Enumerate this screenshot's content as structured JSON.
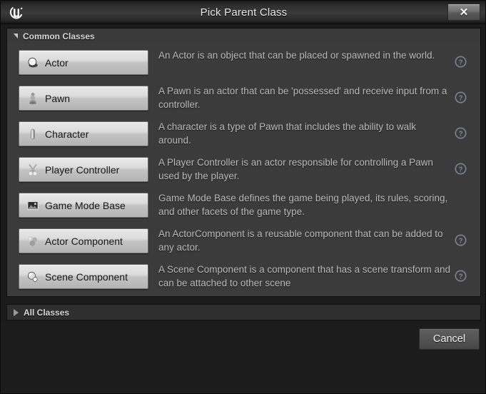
{
  "window": {
    "title": "Pick Parent Class",
    "logo_icon": "unreal-engine-logo",
    "close_icon": "close-icon",
    "close_glyph": "✕"
  },
  "common_section": {
    "label": "Common Classes",
    "expanded": true,
    "expander_icon": "chevron-down-icon",
    "items": [
      {
        "label": "Actor",
        "icon": "actor-sphere-icon",
        "description": "An Actor is an object that can be placed or spawned in the world.",
        "has_help": true,
        "help_icon": "help-circle-icon"
      },
      {
        "label": "Pawn",
        "icon": "pawn-icon",
        "description": "A Pawn is an actor that can be 'possessed' and receive input from a controller.",
        "has_help": true,
        "help_icon": "help-circle-icon"
      },
      {
        "label": "Character",
        "icon": "character-capsule-icon",
        "description": "A character is a type of Pawn that includes the ability to walk around.",
        "has_help": true,
        "help_icon": "help-circle-icon"
      },
      {
        "label": "Player Controller",
        "icon": "player-controller-icon",
        "description": "A Player Controller is an actor responsible for controlling a Pawn used by the player.",
        "has_help": true,
        "help_icon": "help-circle-icon"
      },
      {
        "label": "Game Mode Base",
        "icon": "game-mode-base-icon",
        "description": "Game Mode Base defines the game being played, its rules, scoring, and other facets of the game type.",
        "has_help": false,
        "help_icon": "help-circle-icon"
      },
      {
        "label": "Actor Component",
        "icon": "actor-component-icon",
        "description": "An ActorComponent is a reusable component that can be added to any actor.",
        "has_help": true,
        "help_icon": "help-circle-icon"
      },
      {
        "label": "Scene Component",
        "icon": "scene-component-icon",
        "description": "A Scene Component is a component that has a scene transform and can be attached to other scene",
        "has_help": true,
        "help_icon": "help-circle-icon"
      }
    ]
  },
  "all_section": {
    "label": "All Classes",
    "expanded": false,
    "expander_icon": "chevron-right-icon"
  },
  "footer": {
    "cancel_label": "Cancel"
  },
  "colors": {
    "window_bg": "#1b1b1b",
    "panel_bg": "#3b3b3b",
    "titlebar_bg": "#3a3a3a",
    "button_face": "#dcdcdc",
    "text_light": "#b9b9b9",
    "help_icon": "#7b8496"
  }
}
